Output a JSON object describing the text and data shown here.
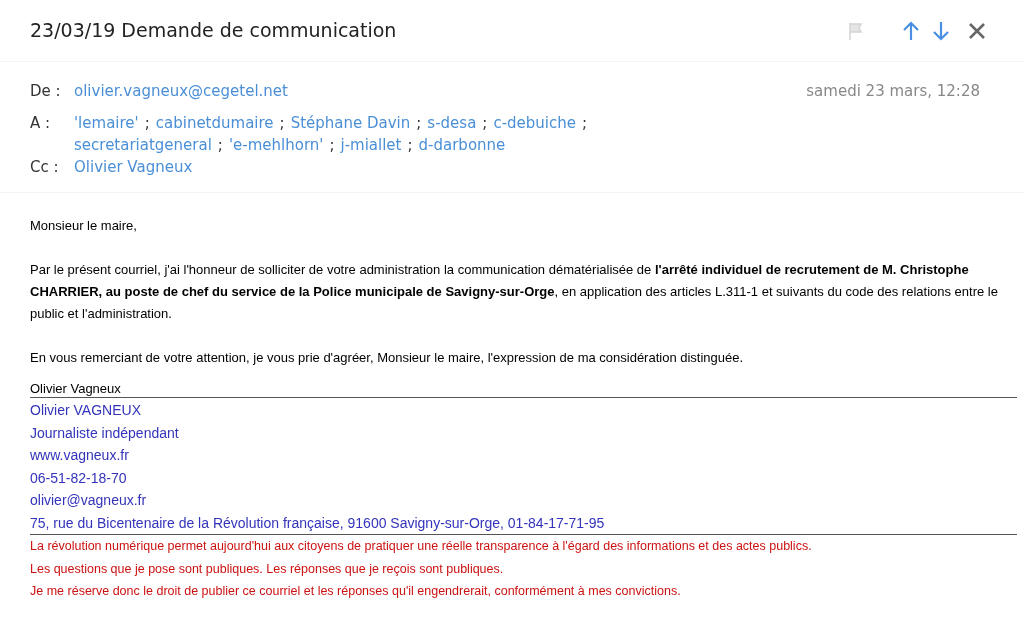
{
  "subject": "23/03/19 Demande de communication",
  "from": {
    "label": "De :",
    "address": "olivier.vagneux@cegetel.net"
  },
  "date": "samedi 23 mars, 12:28",
  "to": {
    "label": "A :",
    "separator": ";",
    "recipients": [
      "'lemaire'",
      "cabinetdumaire",
      "Stéphane Davin",
      "s-desa",
      "c-debuiche",
      "secretariatgeneral",
      "'e-mehlhorn'",
      "j-miallet",
      "d-darbonne"
    ]
  },
  "cc": {
    "label": "Cc :",
    "recipients": [
      "Olivier Vagneux"
    ]
  },
  "body": [
    "Monsieur le maire,",
    "Par le présent courriel, j'ai l'honneur de solliciter de votre administration la communication dématérialisée de **l'arrêté individuel de recrutement de M. Christophe CHARRIER, au poste de chef du service de la Police municipale de Savigny-sur-Orge**, en application des articles L.311-1 et suivants du code des relations entre le public et l'administration.",
    "En vous remerciant de votre attention, je vous prie d'agréer, Monsieur le maire, l'expression de ma considération distinguée."
  ],
  "signature_name": "Olivier Vagneux",
  "signature_lines": [
    "Olivier VAGNEUX",
    "Journaliste indépendant",
    "www.vagneux.fr",
    "06-51-82-18-70",
    "olivier@vagneux.fr",
    "75, rue du Bicentenaire de la Révolution française, 91600 Savigny-sur-Orge, 01-84-17-71-95"
  ],
  "notice_lines": [
    "La révolution numérique permet aujourd'hui aux citoyens de pratiquer une réelle transparence à l'égard des informations et des actes publics.",
    "Les questions que je pose sont publiques. Les réponses que je reçois sont publiques.",
    "Je me réserve donc le droit de publier ce courriel et les réponses qu'il engendrerait, conformément à mes convictions."
  ]
}
